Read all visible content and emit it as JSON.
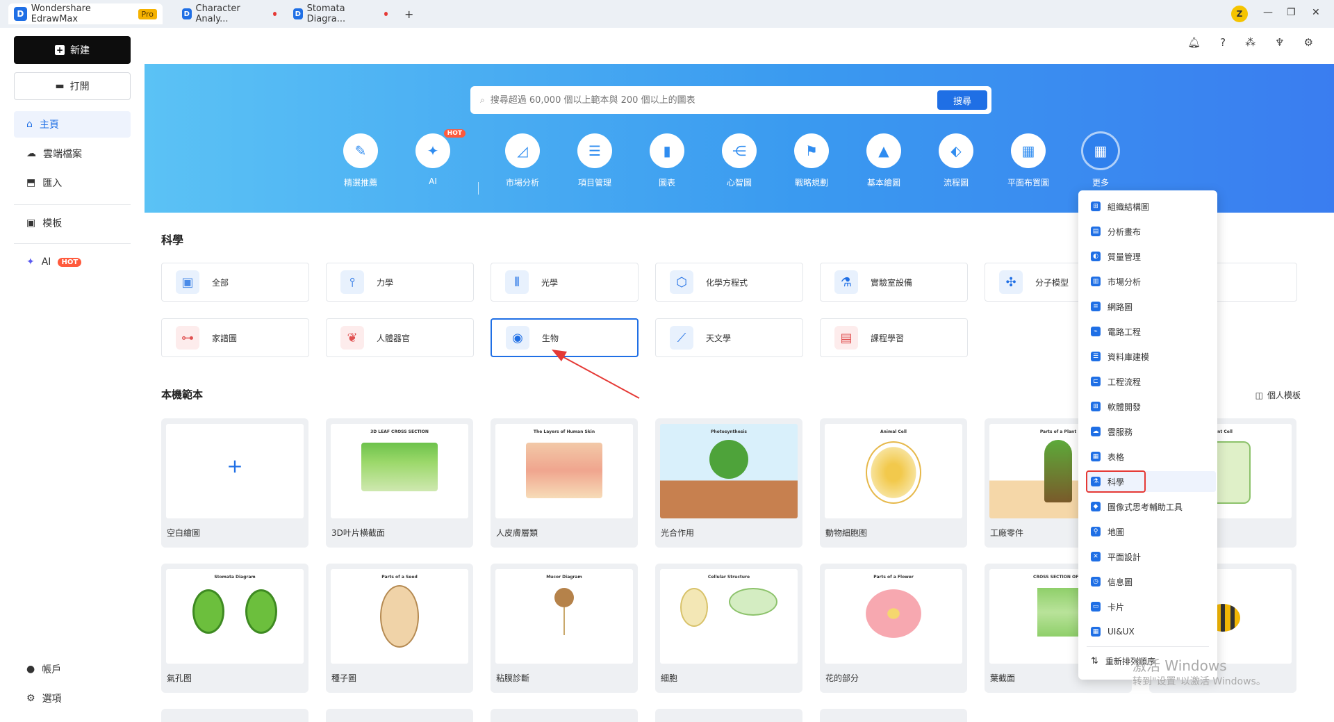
{
  "titlebar": {
    "app_tab": {
      "title": "Wondershare EdrawMax",
      "badge": "Pro"
    },
    "doc_tabs": [
      {
        "title": "Character Analy..."
      },
      {
        "title": "Stomata Diagra..."
      }
    ],
    "new_tab_label": "+",
    "avatar_letter": "Z"
  },
  "sidebar": {
    "new_label": "新建",
    "open_label": "打開",
    "nav": [
      {
        "label": "主頁",
        "icon": "home-icon",
        "active": true
      },
      {
        "label": "雲端檔案",
        "icon": "cloud-icon"
      },
      {
        "label": "匯入",
        "icon": "import-icon"
      },
      {
        "label": "模板",
        "icon": "template-icon"
      },
      {
        "label": "AI",
        "icon": "ai-sparkle-icon",
        "badge": "HOT"
      }
    ],
    "bottom": [
      {
        "label": "帳戶",
        "icon": "account-icon"
      },
      {
        "label": "選項",
        "icon": "settings-icon"
      }
    ]
  },
  "search": {
    "placeholder": "搜尋超過 60,000 個以上範本與 200 個以上的圖表",
    "button_label": "搜尋"
  },
  "categories": [
    {
      "label": "精選推薦",
      "icon": "recommend-icon"
    },
    {
      "label": "AI",
      "icon": "ai-icon",
      "badge": "HOT"
    },
    {
      "label": "市場分析",
      "icon": "market-chart-icon"
    },
    {
      "label": "項目管理",
      "icon": "project-icon"
    },
    {
      "label": "圖表",
      "icon": "bar-chart-icon"
    },
    {
      "label": "心智圖",
      "icon": "mindmap-icon"
    },
    {
      "label": "戰略規劃",
      "icon": "strategy-icon"
    },
    {
      "label": "基本繪圖",
      "icon": "basic-drawing-icon"
    },
    {
      "label": "流程圖",
      "icon": "flowchart-icon"
    },
    {
      "label": "平面布置圖",
      "icon": "floorplan-icon"
    },
    {
      "label": "更多",
      "icon": "grid-more-icon"
    }
  ],
  "science": {
    "title": "科學",
    "chips": [
      {
        "label": "全部",
        "icon": "images-icon",
        "color": "#e8f1fd"
      },
      {
        "label": "力學",
        "icon": "mechanics-icon",
        "color": "#e8f1fd"
      },
      {
        "label": "光學",
        "icon": "optics-icon",
        "color": "#e8f1fd"
      },
      {
        "label": "化學方程式",
        "icon": "chemistry-icon",
        "color": "#e8f1fd"
      },
      {
        "label": "實驗室設備",
        "icon": "microscope-icon",
        "color": "#e8f1fd"
      },
      {
        "label": "分子模型",
        "icon": "molecule-icon",
        "color": "#e8f1fd"
      },
      {
        "label": "",
        "icon": "",
        "color": "#ffffff"
      },
      {
        "label": "家譜圖",
        "icon": "family-tree-icon",
        "color": "#fdecec"
      },
      {
        "label": "人體器官",
        "icon": "lungs-icon",
        "color": "#fdecec"
      },
      {
        "label": "生物",
        "icon": "cell-icon",
        "color": "#e8f1fd",
        "selected": true
      },
      {
        "label": "天文學",
        "icon": "telescope-icon",
        "color": "#e8f1fd"
      },
      {
        "label": "課程學習",
        "icon": "clipboard-icon",
        "color": "#fdecec"
      }
    ]
  },
  "local_templates": {
    "title": "本機範本",
    "personal_label": "個人模板",
    "row1": [
      {
        "label": "空白繪圖",
        "thumb_title": "",
        "blank": true
      },
      {
        "label": "3D叶片横截面",
        "thumb_title": "3D LEAF CROSS SECTION"
      },
      {
        "label": "人皮膚層類",
        "thumb_title": "The Layers of Human Skin"
      },
      {
        "label": "光合作用",
        "thumb_title": "Photosynthesis"
      },
      {
        "label": "動物細胞图",
        "thumb_title": "Animal Cell"
      },
      {
        "label": "工廠零件",
        "thumb_title": "Parts of a Plant"
      },
      {
        "label": "",
        "thumb_title": "lant Cell"
      }
    ],
    "row2": [
      {
        "label": "氣孔图",
        "thumb_title": "Stomata Diagram"
      },
      {
        "label": "種子圖",
        "thumb_title": "Parts of a Seed"
      },
      {
        "label": "粘膜診斷",
        "thumb_title": "Mucor Diagram"
      },
      {
        "label": "細胞",
        "thumb_title": "Cellular Structure"
      },
      {
        "label": "花的部分",
        "thumb_title": "Parts of a Flower"
      },
      {
        "label": "葉截面",
        "thumb_title": "CROSS SECTION OF A"
      },
      {
        "label": "",
        "thumb_title": ""
      }
    ]
  },
  "more_menu": {
    "items": [
      {
        "label": "組織結構圖",
        "icon": "org-chart-icon"
      },
      {
        "label": "分析畫布",
        "icon": "canvas-icon"
      },
      {
        "label": "質量管理",
        "icon": "quality-icon"
      },
      {
        "label": "市場分析",
        "icon": "market-icon"
      },
      {
        "label": "網路圖",
        "icon": "network-icon"
      },
      {
        "label": "電路工程",
        "icon": "circuit-icon"
      },
      {
        "label": "資料庫建模",
        "icon": "database-icon"
      },
      {
        "label": "工程流程",
        "icon": "engineering-icon"
      },
      {
        "label": "軟體開發",
        "icon": "software-icon"
      },
      {
        "label": "雲服務",
        "icon": "cloud-service-icon"
      },
      {
        "label": "表格",
        "icon": "table-icon"
      },
      {
        "label": "科學",
        "icon": "flask-icon",
        "highlighted": true
      },
      {
        "label": "圖像式思考輔助工具",
        "icon": "graphic-organizer-icon"
      },
      {
        "label": "地圖",
        "icon": "map-icon"
      },
      {
        "label": "平面設計",
        "icon": "graphic-design-icon"
      },
      {
        "label": "信息圖",
        "icon": "infographic-icon"
      },
      {
        "label": "卡片",
        "icon": "card-icon"
      },
      {
        "label": "UI&UX",
        "icon": "uiux-icon"
      }
    ],
    "reorder_label": "重新排列順序"
  },
  "watermark": {
    "line1": "激活 Windows",
    "line2": "转到\"设置\"以激活 Windows。"
  },
  "colors": {
    "accent": "#1f6fe5",
    "hot": "#ff5a3c",
    "highlight_box": "#e53935"
  }
}
